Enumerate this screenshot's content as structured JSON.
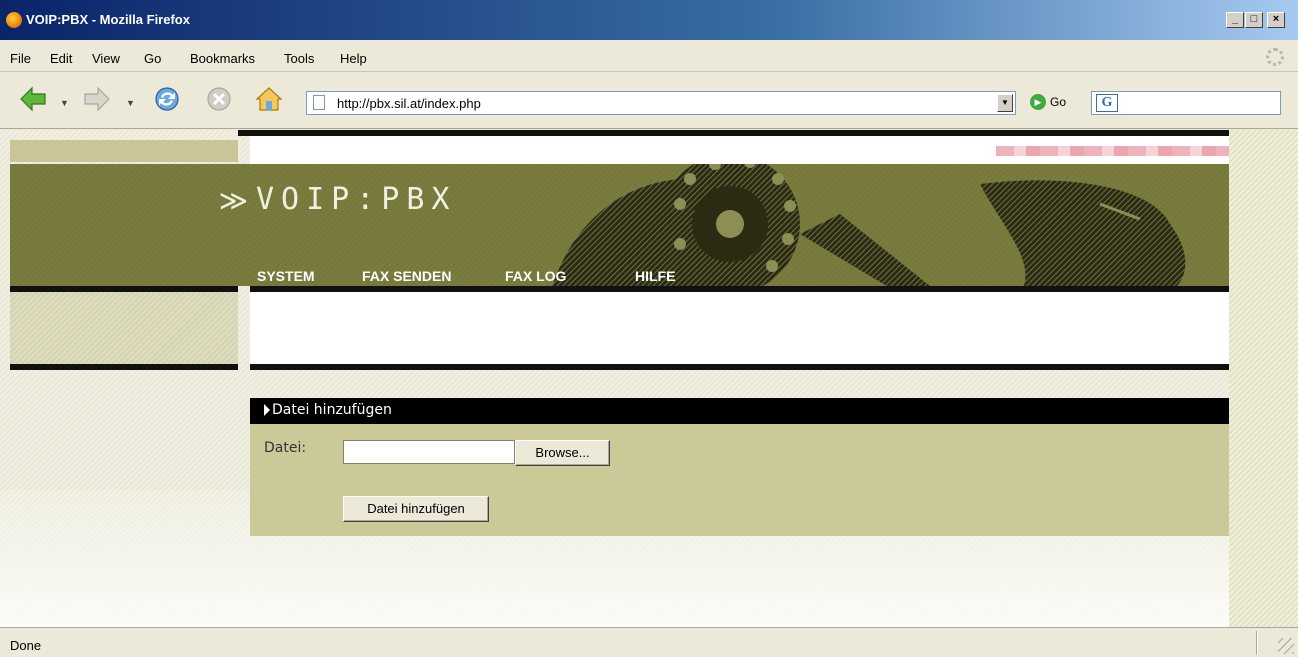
{
  "window": {
    "title": "VOIP:PBX - Mozilla Firefox",
    "controls": {
      "minimize": "_",
      "maximize": "□",
      "close": "×"
    }
  },
  "menubar": {
    "items": [
      {
        "label": "File"
      },
      {
        "label": "Edit"
      },
      {
        "label": "View"
      },
      {
        "label": "Go"
      },
      {
        "label": "Bookmarks"
      },
      {
        "label": "Tools"
      },
      {
        "label": "Help"
      }
    ]
  },
  "toolbar": {
    "url": "http://pbx.sil.at/index.php",
    "go_label": "Go",
    "search_value": ""
  },
  "page": {
    "brand": "VOIP:PBX",
    "logo_mark": "≫",
    "nav": [
      {
        "label": "SYSTEM"
      },
      {
        "label": "FAX SENDEN"
      },
      {
        "label": "FAX LOG"
      },
      {
        "label": "HILFE"
      }
    ],
    "panel": {
      "title": "Datei hinzufügen",
      "field_label": "Datei:",
      "file_value": "",
      "browse_label": "Browse...",
      "submit_label": "Datei hinzufügen"
    }
  },
  "statusbar": {
    "text": "Done"
  },
  "colors": {
    "banner_olive": "#7a7b3e",
    "panel_tan": "#ccc999",
    "accent_black": "#111111"
  }
}
